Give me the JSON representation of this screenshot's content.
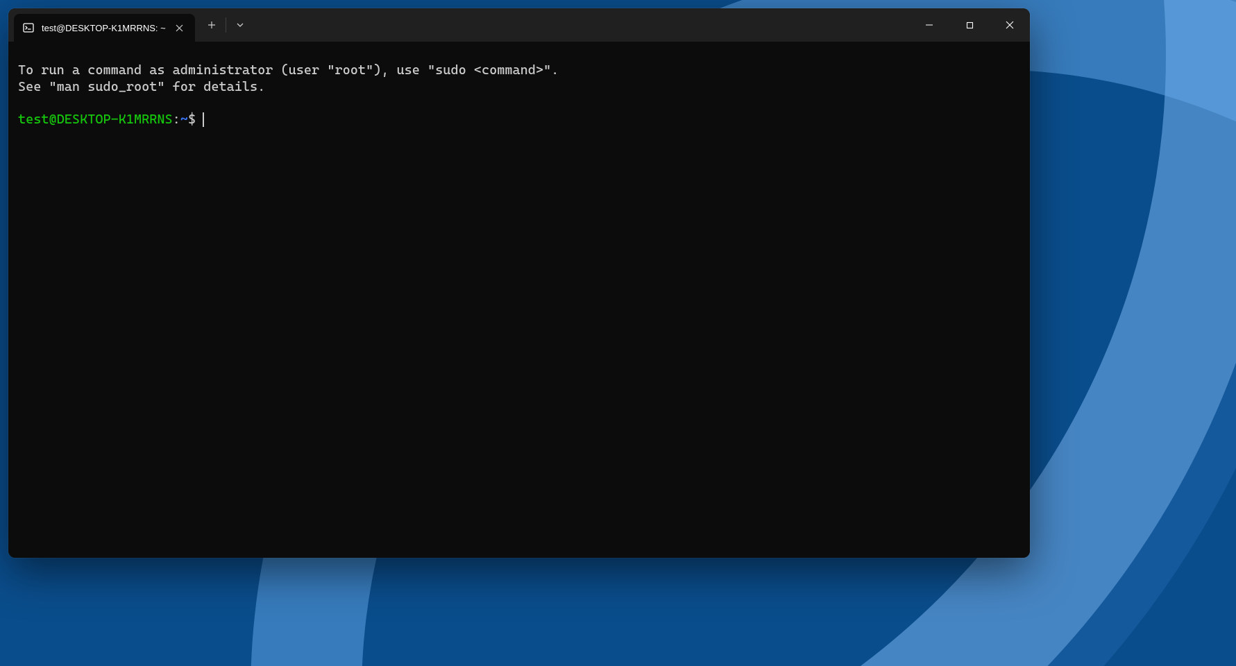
{
  "tab": {
    "title": "test@DESKTOP-K1MRRNS: ~",
    "icon": "terminal"
  },
  "motd": {
    "line1": "To run a command as administrator (user \"root\"), use \"sudo <command>\".",
    "line2": "See \"man sudo_root\" for details."
  },
  "prompt": {
    "user_host": "test@DESKTOP-K1MRRNS",
    "separator": ":",
    "path": "~",
    "symbol": "$",
    "input": ""
  },
  "colors": {
    "window_bg": "#0c0c0c",
    "titlebar_bg": "#202020",
    "text": "#cccccc",
    "prompt_user": "#16c60c",
    "prompt_path": "#3b78ff"
  }
}
